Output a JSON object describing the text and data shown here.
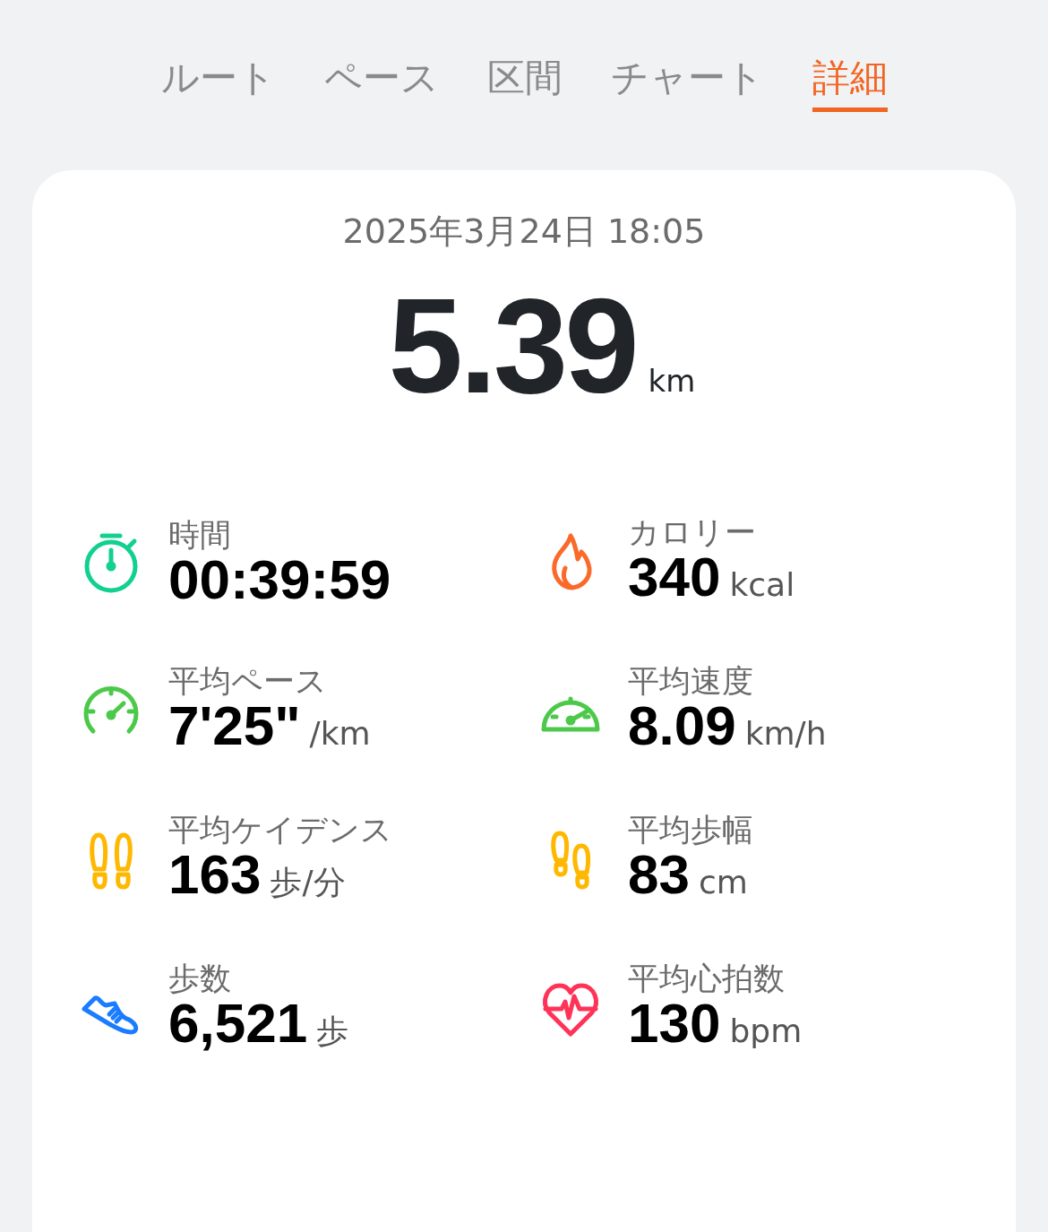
{
  "tabs": [
    {
      "label": "ルート",
      "selected": false
    },
    {
      "label": "ペース",
      "selected": false
    },
    {
      "label": "区間",
      "selected": false
    },
    {
      "label": "チャート",
      "selected": false
    },
    {
      "label": "詳細",
      "selected": true
    }
  ],
  "date": "2025年3月24日 18:05",
  "distance": {
    "value": "5.39",
    "unit": "km"
  },
  "metrics": [
    {
      "label": "時間",
      "value": "00:39:59",
      "color": "#12d18e"
    },
    {
      "label": "カロリー",
      "value": "340",
      "unit": "kcal",
      "color": "#fa6a2a"
    },
    {
      "label": "平均ペース",
      "value": "7'25\"",
      "unit": "/km",
      "color": "#4cc94a"
    },
    {
      "label": "平均速度",
      "value": "8.09",
      "unit": "km/h",
      "color": "#4cc94a"
    },
    {
      "label": "平均ケイデンス",
      "value": "163",
      "unit": "歩/分",
      "color": "#ffb800"
    },
    {
      "label": "平均歩幅",
      "value": "83",
      "unit": "cm",
      "color": "#ffb800"
    },
    {
      "label": "歩数",
      "value": "6,521",
      "unit": "歩",
      "color": "#1a7cff"
    },
    {
      "label": "平均心拍数",
      "value": "130",
      "unit": "bpm",
      "color": "#ff3358"
    }
  ]
}
